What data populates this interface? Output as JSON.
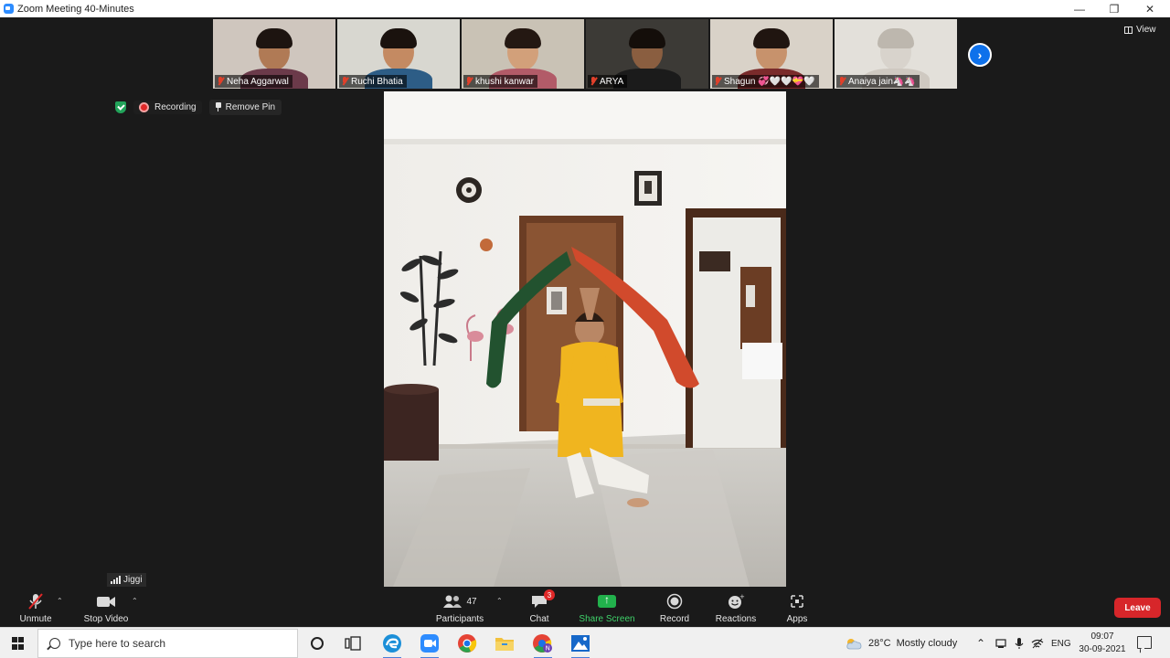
{
  "window": {
    "title": "Zoom Meeting 40-Minutes",
    "controls": {
      "minimize": "—",
      "restore": "❐",
      "close": "✕"
    }
  },
  "thumbnails": [
    {
      "name": "Neha Aggarwal",
      "bg": "#cfc6be",
      "skin": "#b07a55",
      "shirt": "#6b3a4a",
      "hair": "#1d1410"
    },
    {
      "name": "Ruchi Bhatia",
      "bg": "#d8d7d0",
      "skin": "#c48a62",
      "shirt": "#2d5d86",
      "hair": "#1a120e"
    },
    {
      "name": "khushi kanwar",
      "bg": "#c9c2b5",
      "skin": "#d2a07a",
      "shirt": "#b25b68",
      "hair": "#241812"
    },
    {
      "name": "ARYA",
      "bg": "#3c3a36",
      "skin": "#8a5e40",
      "shirt": "#1b1b1b",
      "hair": "#140e0a"
    },
    {
      "name": "Shagun 💞🤍🤍💝🤍",
      "bg": "#d9d2c8",
      "skin": "#c7926c",
      "shirt": "#7a2b2b",
      "hair": "#201510"
    },
    {
      "name": "Anaiya jain🦄🦄",
      "bg": "#e3e0da",
      "skin": "#d8d3cc",
      "shirt": "#cfc9c1",
      "hair": "#bdb7ae"
    }
  ],
  "view_label": "View",
  "status": {
    "recording_label": "Recording",
    "remove_pin_label": "Remove Pin"
  },
  "active_speaker": "Jiggi",
  "toolbar": {
    "unmute": "Unmute",
    "stop_video": "Stop Video",
    "participants": "Participants",
    "participants_count": "47",
    "chat": "Chat",
    "chat_badge": "3",
    "share_screen": "Share Screen",
    "record": "Record",
    "reactions": "Reactions",
    "apps": "Apps",
    "leave": "Leave"
  },
  "taskbar": {
    "search_placeholder": "Type here to search",
    "weather_temp": "28°C",
    "weather_text": "Mostly cloudy",
    "language": "ENG",
    "time": "09:07",
    "date": "30-09-2021"
  },
  "colors": {
    "accent": "#0e71eb",
    "leave": "#d7262a",
    "share": "#22b14c",
    "recording": "#e02828"
  }
}
